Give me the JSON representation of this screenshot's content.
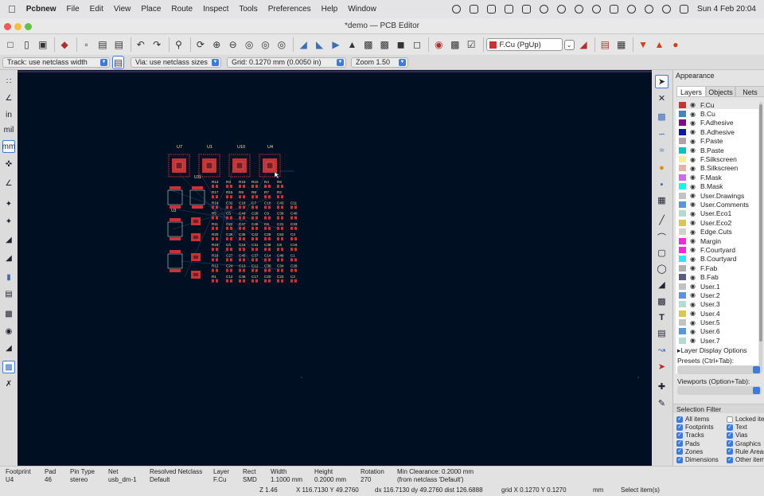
{
  "menubar": {
    "app": "Pcbnew",
    "items": [
      "File",
      "Edit",
      "View",
      "Place",
      "Route",
      "Inspect",
      "Tools",
      "Preferences",
      "Help",
      "Window"
    ],
    "datetime": "Sun 4 Feb  20:04"
  },
  "window": {
    "title": "*demo — PCB Editor"
  },
  "toolbar": {
    "layer_label": "F.Cu (PgUp)",
    "layer_color": "#c83434"
  },
  "options": {
    "track": "Track: use netclass width",
    "via": "Via: use netclass sizes",
    "grid": "Grid: 0.1270 mm (0.0050 in)",
    "zoom": "Zoom 1.50"
  },
  "board": {
    "ics": [
      "U7",
      "U1",
      "U10",
      "U4"
    ],
    "ic_small_left": "U3",
    "ic_small_mid": "U11",
    "rows": [
      [
        "R13",
        "R3",
        "R19",
        "R10",
        "R4",
        "R6"
      ],
      [
        "R17",
        "R15",
        "R9",
        "R8",
        "R7",
        "R2"
      ],
      [
        "R14",
        "C32",
        "C18",
        "C7",
        "C10",
        "C43",
        "C11"
      ],
      [
        "R5",
        "C5",
        "C44",
        "C28",
        "C9",
        "C39",
        "C40"
      ],
      [
        "R11",
        "C22",
        "C47",
        "C46",
        "C6",
        "C21",
        "C33"
      ],
      [
        "R20",
        "C36",
        "C35",
        "C42",
        "C25",
        "C53",
        "C3"
      ],
      [
        "R18",
        "C4",
        "C15",
        "C31",
        "C39",
        "C8",
        "C16"
      ],
      [
        "R16",
        "C27",
        "C45",
        "C37",
        "C14",
        "C48",
        "C1"
      ],
      [
        "R12",
        "C24",
        "C13",
        "C12",
        "C30",
        "C34",
        "C29"
      ],
      [
        "R1",
        "C12",
        "C46",
        "C17",
        "C20",
        "C23",
        "C2"
      ]
    ]
  },
  "appearance": {
    "title": "Appearance",
    "tabs": [
      "Layers",
      "Objects",
      "Nets"
    ],
    "layers": [
      {
        "name": "F.Cu",
        "color": "#c83434"
      },
      {
        "name": "B.Cu",
        "color": "#4d7fc4"
      },
      {
        "name": "F.Adhesive",
        "color": "#84008a"
      },
      {
        "name": "B.Adhesive",
        "color": "#0c1aa6"
      },
      {
        "name": "F.Paste",
        "color": "#b4a2a6"
      },
      {
        "name": "B.Paste",
        "color": "#00c2c2"
      },
      {
        "name": "F.Silkscreen",
        "color": "#f2eda1"
      },
      {
        "name": "B.Silkscreen",
        "color": "#e8b2a7"
      },
      {
        "name": "F.Mask",
        "color": "#d864ff"
      },
      {
        "name": "B.Mask",
        "color": "#02ffee"
      },
      {
        "name": "User.Drawings",
        "color": "#c2c2c2"
      },
      {
        "name": "User.Comments",
        "color": "#5994dc"
      },
      {
        "name": "User.Eco1",
        "color": "#b4dbd2"
      },
      {
        "name": "User.Eco2",
        "color": "#d8c852"
      },
      {
        "name": "Edge.Cuts",
        "color": "#d0d2cd"
      },
      {
        "name": "Margin",
        "color": "#ff26e2"
      },
      {
        "name": "F.Courtyard",
        "color": "#ff26e2"
      },
      {
        "name": "B.Courtyard",
        "color": "#26e9ff"
      },
      {
        "name": "F.Fab",
        "color": "#afafaf"
      },
      {
        "name": "B.Fab",
        "color": "#585d84"
      },
      {
        "name": "User.1",
        "color": "#c2c2c2"
      },
      {
        "name": "User.2",
        "color": "#5994dc"
      },
      {
        "name": "User.3",
        "color": "#b4dbd2"
      },
      {
        "name": "User.4",
        "color": "#d8c852"
      },
      {
        "name": "User.5",
        "color": "#c2c2c2"
      },
      {
        "name": "User.6",
        "color": "#5994dc"
      },
      {
        "name": "User.7",
        "color": "#b4dbd2"
      }
    ],
    "layer_display_options": "Layer Display Options",
    "presets_label": "Presets (Ctrl+Tab):",
    "viewports_label": "Viewports (Option+Tab):"
  },
  "selection_filter": {
    "title": "Selection Filter",
    "left": [
      {
        "label": "All items",
        "checked": true
      },
      {
        "label": "Footprints",
        "checked": true
      },
      {
        "label": "Tracks",
        "checked": true
      },
      {
        "label": "Pads",
        "checked": true
      },
      {
        "label": "Zones",
        "checked": true
      },
      {
        "label": "Dimensions",
        "checked": true
      }
    ],
    "right": [
      {
        "label": "Locked items",
        "checked": false
      },
      {
        "label": "Text",
        "checked": true
      },
      {
        "label": "Vias",
        "checked": true
      },
      {
        "label": "Graphics",
        "checked": true
      },
      {
        "label": "Rule Areas",
        "checked": true
      },
      {
        "label": "Other items",
        "checked": true
      }
    ]
  },
  "status": {
    "cols": [
      {
        "h": "Footprint",
        "v": "U4"
      },
      {
        "h": "Pad",
        "v": "46"
      },
      {
        "h": "Pin Type",
        "v": "stereo"
      },
      {
        "h": "Net",
        "v": "usb_dm-1"
      },
      {
        "h": "Resolved Netclass",
        "v": "Default"
      },
      {
        "h": "Layer",
        "v": "F.Cu"
      },
      {
        "h": "Rect",
        "v": "SMD"
      },
      {
        "h": "Width",
        "v": "1.1000 mm"
      },
      {
        "h": "Height",
        "v": "0.2000 mm"
      },
      {
        "h": "Rotation",
        "v": "270"
      },
      {
        "h": "Min Clearance: 0.2000 mm",
        "v": "(from netclass 'Default')"
      }
    ],
    "z": "Z 1.46",
    "xy": "X 116.7130  Y 49.2760",
    "delta": "dx 116.7130  dy 49.2760  dist 126.6888",
    "grid": "grid X 0.1270  Y 0.1270",
    "units": "mm",
    "mode": "Select item(s)"
  }
}
